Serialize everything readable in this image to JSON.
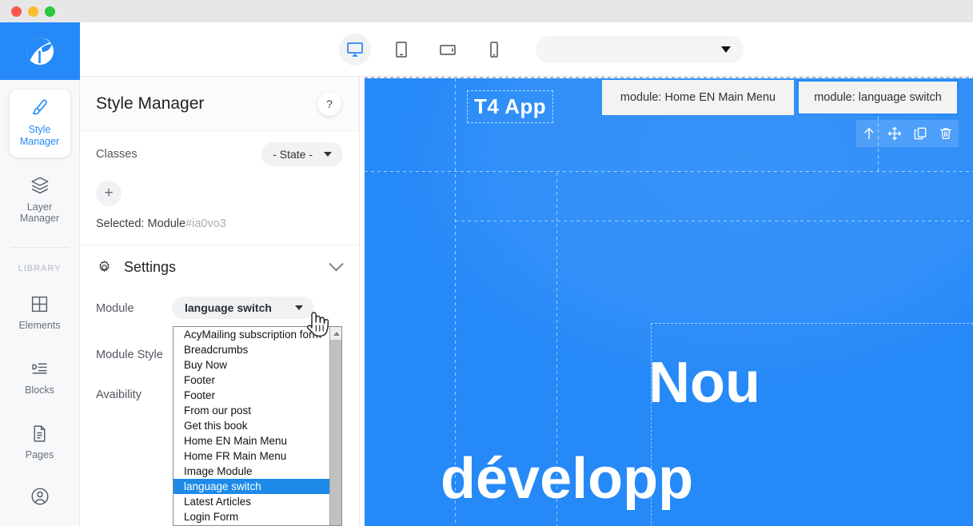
{
  "window": {
    "traffic_lights": [
      "close",
      "minimize",
      "zoom"
    ]
  },
  "sidebar": {
    "brand_icon": "flower-logo-icon",
    "items": [
      {
        "label": "Style\nManager",
        "icon": "brush-icon",
        "active": true
      },
      {
        "label": "Layer\nManager",
        "icon": "layers-icon",
        "active": false
      }
    ],
    "section_label": "LIBRARY",
    "library_items": [
      {
        "label": "Elements",
        "icon": "grid-icon"
      },
      {
        "label": "Blocks",
        "icon": "blocks-icon"
      },
      {
        "label": "Pages",
        "icon": "document-icon"
      },
      {
        "label": "",
        "icon": "user-account-icon"
      }
    ]
  },
  "toolbar": {
    "devices": [
      {
        "name": "desktop",
        "icon": "desktop-icon",
        "active": true
      },
      {
        "name": "tablet",
        "icon": "tablet-icon",
        "active": false
      },
      {
        "name": "tablet-landscape",
        "icon": "tablet-landscape-icon",
        "active": false
      },
      {
        "name": "mobile",
        "icon": "mobile-icon",
        "active": false
      }
    ],
    "page_select_value": "",
    "page_select_caret": "chevron-down-icon"
  },
  "panel": {
    "title": "Style Manager",
    "help_label": "?",
    "classes_label": "Classes",
    "state_value": "- State -",
    "add_class_label": "+",
    "selected_prefix": "Selected:",
    "selected_name": "Module",
    "selected_hash": "#ia0vo3",
    "settings": {
      "icon": "gear-icon",
      "title": "Settings",
      "collapse_icon": "chevron-down-icon",
      "fields": [
        {
          "label": "Module",
          "value": "language switch"
        },
        {
          "label": "Module Style",
          "value": ""
        },
        {
          "label": "Avaibility",
          "value": ""
        }
      ]
    }
  },
  "dropdown": {
    "open": true,
    "selected": "language switch",
    "options": [
      "AcyMailing subscription form",
      "Breadcrumbs",
      "Buy Now",
      "Footer",
      "Footer",
      "From our post",
      "Get this book",
      "Home EN Main Menu",
      "Home FR Main Menu",
      "Image Module",
      "language switch",
      "Latest Articles",
      "Login Form"
    ],
    "scroll_up_icon": "scroll-up-arrow-icon"
  },
  "canvas": {
    "brand_word": "T4 App",
    "badges": [
      {
        "text": "module: Home EN Main Menu",
        "selected": false
      },
      {
        "text": "module: language switch",
        "selected": true
      }
    ],
    "badge_tools": [
      {
        "name": "select-parent",
        "icon": "arrow-up-icon"
      },
      {
        "name": "move",
        "icon": "move-icon"
      },
      {
        "name": "duplicate",
        "icon": "copy-icon"
      },
      {
        "name": "delete",
        "icon": "trash-icon"
      }
    ],
    "hero_line1": "Nou",
    "hero_line2": "développ",
    "background_color": "#2589f8"
  },
  "colors": {
    "accent": "#2589f8",
    "panel_bg": "#ffffff",
    "rail_bg": "#f7f8fa",
    "titlebar": "#e7e7e7",
    "highlight": "#1e8ae8"
  }
}
